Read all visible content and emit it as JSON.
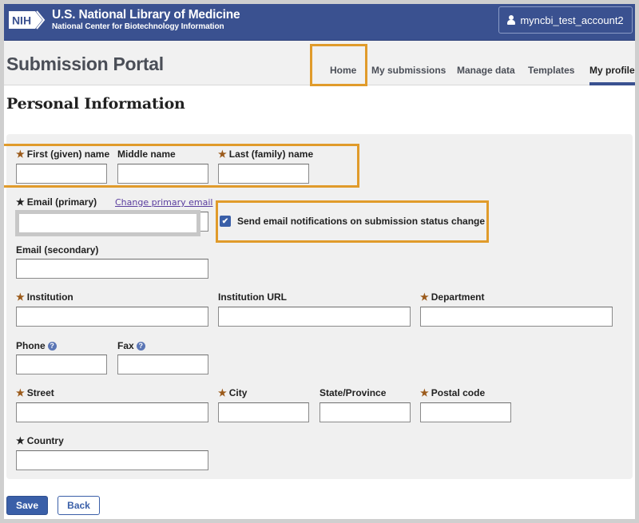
{
  "header": {
    "logo_text": "NIH",
    "org_title": "U.S. National Library of Medicine",
    "org_subtitle": "National Center for Biotechnology Information",
    "account_label": "myncbi_test_account2"
  },
  "subheader": {
    "title": "Submission Portal",
    "nav": [
      {
        "label": "Home",
        "active": false
      },
      {
        "label": "My submissions",
        "active": false
      },
      {
        "label": "Manage data",
        "active": false
      },
      {
        "label": "Templates",
        "active": false
      },
      {
        "label": "My profile",
        "active": true
      }
    ]
  },
  "page": {
    "heading": "Personal Information"
  },
  "form": {
    "first_name": {
      "label": "First (given) name",
      "required": true,
      "value": ""
    },
    "middle_name": {
      "label": "Middle name",
      "required": false,
      "value": ""
    },
    "last_name": {
      "label": "Last (family) name",
      "required": true,
      "value": ""
    },
    "email_primary": {
      "label": "Email (primary)",
      "required": true,
      "value": ""
    },
    "change_email_link": "Change primary email",
    "notify_checkbox": {
      "label": "Send email notifications on submission status change",
      "checked": true
    },
    "email_secondary": {
      "label": "Email (secondary)",
      "required": false,
      "value": ""
    },
    "institution": {
      "label": "Institution",
      "required": true,
      "value": ""
    },
    "institution_url": {
      "label": "Institution URL",
      "required": false,
      "value": ""
    },
    "department": {
      "label": "Department",
      "required": true,
      "value": ""
    },
    "phone": {
      "label": "Phone",
      "required": false,
      "value": ""
    },
    "fax": {
      "label": "Fax",
      "required": false,
      "value": ""
    },
    "street": {
      "label": "Street",
      "required": true,
      "value": ""
    },
    "city": {
      "label": "City",
      "required": true,
      "value": ""
    },
    "state": {
      "label": "State/Province",
      "required": false,
      "value": ""
    },
    "postal_code": {
      "label": "Postal code",
      "required": true,
      "value": ""
    },
    "country": {
      "label": "Country",
      "required": true,
      "value": ""
    }
  },
  "icons": {
    "required": "★",
    "help": "?",
    "check": "✔"
  },
  "buttons": {
    "save": "Save",
    "back": "Back"
  },
  "colors": {
    "brand_blue": "#3a5190",
    "button_blue": "#3a5fa8",
    "required_star": "#9b5a1a",
    "highlight": "#e09b2b",
    "link": "#5a3d9e"
  }
}
